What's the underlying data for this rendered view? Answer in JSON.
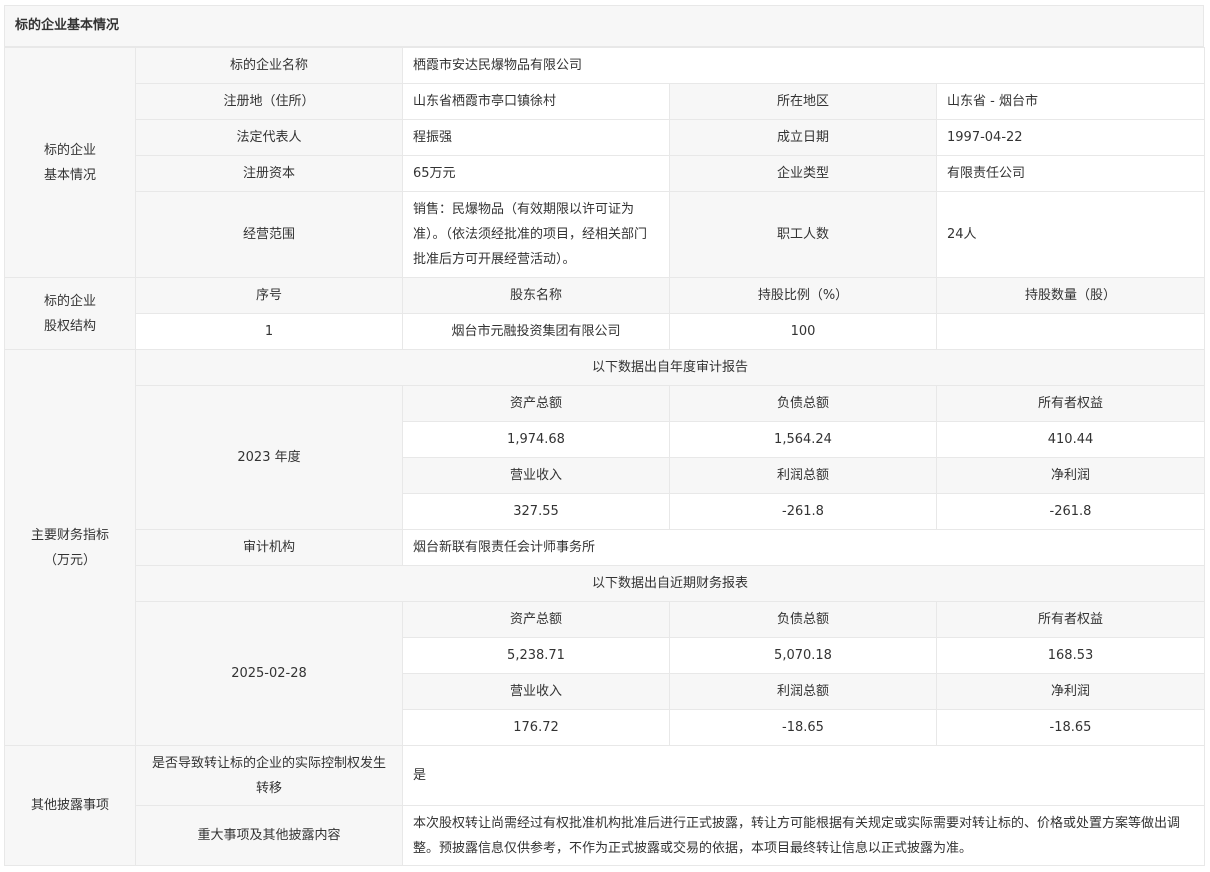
{
  "section_title": "标的企业基本情况",
  "basic": {
    "group_label_1": "标的企业",
    "group_label_2": "基本情况",
    "name_label": "标的企业名称",
    "name_value": "栖霞市安达民爆物品有限公司",
    "reg_label": "注册地（住所）",
    "reg_value": "山东省栖霞市亭口镇徐村",
    "region_label": "所在地区",
    "region_value": "山东省 - 烟台市",
    "legal_label": "法定代表人",
    "legal_value": "程振强",
    "founded_label": "成立日期",
    "founded_value": "1997-04-22",
    "capital_label": "注册资本",
    "capital_value": "65万元",
    "type_label": "企业类型",
    "type_value": "有限责任公司",
    "scope_label": "经营范围",
    "scope_value": "销售：民爆物品（有效期限以许可证为准）。（依法须经批准的项目，经相关部门批准后方可开展经营活动）。",
    "staff_label": "职工人数",
    "staff_value": "24人"
  },
  "equity": {
    "group_label_1": "标的企业",
    "group_label_2": "股权结构",
    "headers": [
      "序号",
      "股东名称",
      "持股比例（%）",
      "持股数量（股）"
    ],
    "rows": [
      [
        "1",
        "烟台市元融投资集团有限公司",
        "100",
        ""
      ]
    ]
  },
  "finance": {
    "group_label_1": "主要财务指标",
    "group_label_2": "（万元）",
    "annual_note": "以下数据出自年度审计报告",
    "annual_period": "2023 年度",
    "annual_headers_1": [
      "资产总额",
      "负债总额",
      "所有者权益"
    ],
    "annual_values_1": [
      "1,974.68",
      "1,564.24",
      "410.44"
    ],
    "annual_headers_2": [
      "营业收入",
      "利润总额",
      "净利润"
    ],
    "annual_values_2": [
      "327.55",
      "-261.8",
      "-261.8"
    ],
    "auditor_label": "审计机构",
    "auditor_value": "烟台新联有限责任会计师事务所",
    "recent_note": "以下数据出自近期财务报表",
    "recent_period": "2025-02-28",
    "recent_headers_1": [
      "资产总额",
      "负债总额",
      "所有者权益"
    ],
    "recent_values_1": [
      "5,238.71",
      "5,070.18",
      "168.53"
    ],
    "recent_headers_2": [
      "营业收入",
      "利润总额",
      "净利润"
    ],
    "recent_values_2": [
      "176.72",
      "-18.65",
      "-18.65"
    ]
  },
  "other": {
    "group_label": "其他披露事项",
    "control_label": "是否导致转让标的企业的实际控制权发生转移",
    "control_value": "是",
    "major_label": "重大事项及其他披露内容",
    "major_value": "本次股权转让尚需经过有权批准机构批准后进行正式披露，转让方可能根据有关规定或实际需要对转让标的、价格或处置方案等做出调整。预披露信息仅供参考，不作为正式披露或交易的依据，本项目最终转让信息以正式披露为准。"
  }
}
